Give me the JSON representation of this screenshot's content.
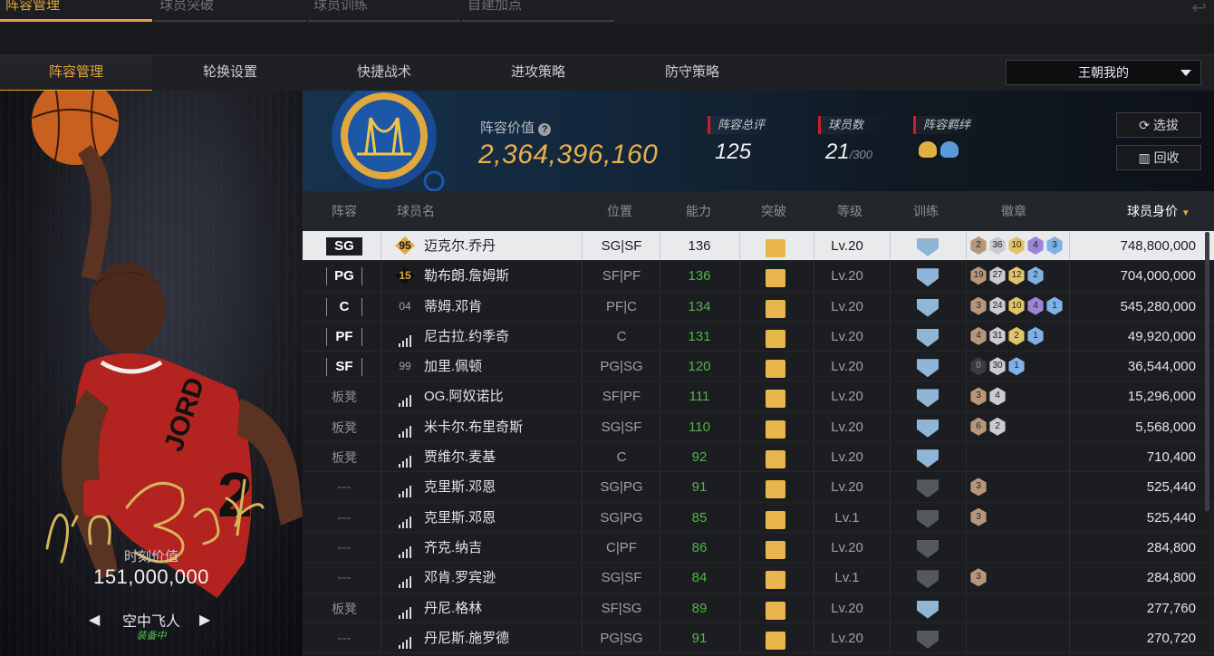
{
  "top_tabs": [
    {
      "label": "阵容管理",
      "active": true
    },
    {
      "label": "球员突破",
      "active": false
    },
    {
      "label": "球员训练",
      "active": false
    },
    {
      "label": "自建加点",
      "active": false
    }
  ],
  "sub_tabs": [
    {
      "label": "阵容管理",
      "active": true
    },
    {
      "label": "轮换设置",
      "active": false
    },
    {
      "label": "快捷战术",
      "active": false
    },
    {
      "label": "进攻策略",
      "active": false
    },
    {
      "label": "防守策略",
      "active": false
    }
  ],
  "team_select": {
    "value": "王朝我的"
  },
  "hero": {
    "moment_label": "时刻价值",
    "moment_value": "151,000,000",
    "card_name": "空中飞人",
    "equipped": "装备中",
    "signature": "I'm Back"
  },
  "banner": {
    "value_label": "阵容价值",
    "value": "2,364,396,160",
    "rating_label": "阵容总评",
    "rating": "125",
    "players_label": "球员数",
    "players": "21",
    "players_max": "/300",
    "bond_label": "阵容羁绊",
    "btn_select": "选拔",
    "btn_recycle": "回收"
  },
  "table": {
    "headers": {
      "lineup": "阵容",
      "name": "球员名",
      "position": "位置",
      "ability": "能力",
      "breakthrough": "突破",
      "level": "等级",
      "training": "训练",
      "badges": "徽章",
      "price": "球员身价"
    },
    "rows": [
      {
        "slot": "SG",
        "slot_type": "starter",
        "num": "95",
        "num_style": "gold",
        "name": "迈克尔.乔丹",
        "pos": "SG|SF",
        "ability": "136",
        "level": "Lv.20",
        "training": "blue",
        "badges": [
          [
            "bronze",
            "2"
          ],
          [
            "silver",
            "36"
          ],
          [
            "gold",
            "10"
          ],
          [
            "purple",
            "4"
          ],
          [
            "blue",
            "3"
          ]
        ],
        "price": "748,800,000",
        "selected": true
      },
      {
        "slot": "PG",
        "slot_type": "starter",
        "num": "15",
        "num_style": "dark",
        "name": "勒布朗.詹姆斯",
        "pos": "SF|PF",
        "ability": "136",
        "level": "Lv.20",
        "training": "blue",
        "badges": [
          [
            "bronze",
            "19"
          ],
          [
            "silver",
            "27"
          ],
          [
            "gold",
            "12"
          ],
          [
            "blue",
            "2"
          ]
        ],
        "price": "704,000,000"
      },
      {
        "slot": "C",
        "slot_type": "starter",
        "num": "04",
        "num_style": "plain",
        "name": "蒂姆.邓肯",
        "pos": "PF|C",
        "ability": "134",
        "level": "Lv.20",
        "training": "blue",
        "badges": [
          [
            "bronze",
            "3"
          ],
          [
            "silver",
            "24"
          ],
          [
            "gold",
            "10"
          ],
          [
            "purple",
            "4"
          ],
          [
            "blue",
            "1"
          ]
        ],
        "price": "545,280,000"
      },
      {
        "slot": "PF",
        "slot_type": "starter",
        "num": "",
        "num_style": "signal",
        "name": "尼古拉.约季奇",
        "pos": "C",
        "ability": "131",
        "level": "Lv.20",
        "training": "blue",
        "badges": [
          [
            "bronze",
            "4"
          ],
          [
            "silver",
            "31"
          ],
          [
            "gold",
            "2"
          ],
          [
            "blue",
            "1"
          ]
        ],
        "price": "49,920,000"
      },
      {
        "slot": "SF",
        "slot_type": "starter",
        "num": "99",
        "num_style": "plain",
        "name": "加里.佩顿",
        "pos": "PG|SG",
        "ability": "120",
        "level": "Lv.20",
        "training": "blue",
        "badges": [
          [
            "black",
            "0"
          ],
          [
            "silver",
            "30"
          ],
          [
            "blue",
            "1"
          ]
        ],
        "price": "36,544,000"
      },
      {
        "slot": "板凳",
        "slot_type": "bench",
        "num": "",
        "num_style": "signal",
        "name": "OG.阿奴诺比",
        "pos": "SF|PF",
        "ability": "111",
        "level": "Lv.20",
        "training": "blue",
        "badges": [
          [
            "bronze",
            "3"
          ],
          [
            "silver",
            "4"
          ]
        ],
        "price": "15,296,000"
      },
      {
        "slot": "板凳",
        "slot_type": "bench",
        "num": "",
        "num_style": "signal",
        "name": "米卡尔.布里奇斯",
        "pos": "SG|SF",
        "ability": "110",
        "level": "Lv.20",
        "training": "blue",
        "badges": [
          [
            "bronze",
            "6"
          ],
          [
            "silver",
            "2"
          ]
        ],
        "price": "5,568,000"
      },
      {
        "slot": "板凳",
        "slot_type": "bench",
        "num": "",
        "num_style": "signal",
        "name": "贾维尔.麦基",
        "pos": "C",
        "ability": "92",
        "level": "Lv.20",
        "training": "blue",
        "badges": [],
        "price": "710,400"
      },
      {
        "slot": "---",
        "slot_type": "none",
        "num": "",
        "num_style": "signal",
        "name": "克里斯.邓恩",
        "pos": "SG|PG",
        "ability": "91",
        "level": "Lv.20",
        "training": "grey",
        "badges": [
          [
            "bronze",
            "3"
          ]
        ],
        "price": "525,440"
      },
      {
        "slot": "---",
        "slot_type": "none",
        "num": "",
        "num_style": "signal",
        "name": "克里斯.邓恩",
        "pos": "SG|PG",
        "ability": "85",
        "level": "Lv.1",
        "training": "grey",
        "badges": [
          [
            "bronze",
            "3"
          ]
        ],
        "price": "525,440"
      },
      {
        "slot": "---",
        "slot_type": "none",
        "num": "",
        "num_style": "signal",
        "name": "齐克.纳吉",
        "pos": "C|PF",
        "ability": "86",
        "level": "Lv.20",
        "training": "grey",
        "badges": [],
        "price": "284,800"
      },
      {
        "slot": "---",
        "slot_type": "none",
        "num": "",
        "num_style": "signal",
        "name": "邓肯.罗宾逊",
        "pos": "SG|SF",
        "ability": "84",
        "level": "Lv.1",
        "training": "grey",
        "badges": [
          [
            "bronze",
            "3"
          ]
        ],
        "price": "284,800"
      },
      {
        "slot": "板凳",
        "slot_type": "bench",
        "num": "",
        "num_style": "signal",
        "name": "丹尼.格林",
        "pos": "SF|SG",
        "ability": "89",
        "level": "Lv.20",
        "training": "blue",
        "badges": [],
        "price": "277,760"
      },
      {
        "slot": "---",
        "slot_type": "none",
        "num": "",
        "num_style": "signal",
        "name": "丹尼斯.施罗德",
        "pos": "PG|SG",
        "ability": "91",
        "level": "Lv.20",
        "training": "grey",
        "badges": [],
        "price": "270,720"
      }
    ]
  }
}
